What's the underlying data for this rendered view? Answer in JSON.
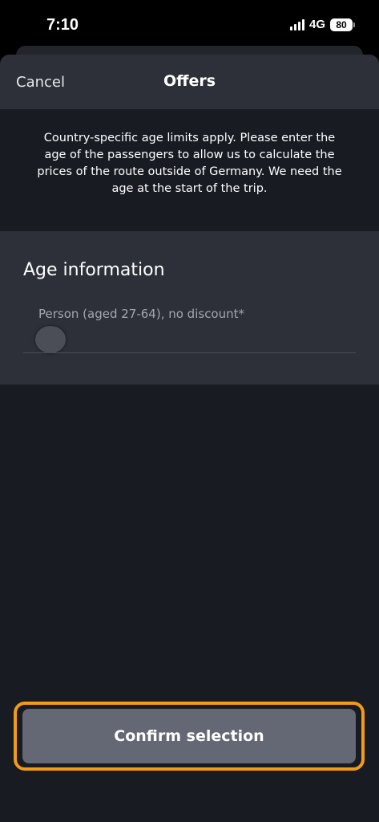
{
  "status_bar": {
    "time": "7:10",
    "network": "4G",
    "battery": "80"
  },
  "nav": {
    "cancel_label": "Cancel",
    "title": "Offers"
  },
  "info_text": "Country-specific age limits apply. Please enter the age of the passengers to allow us to calculate the prices of the route outside of Germany. We need the age at the start of the trip.",
  "age_section": {
    "title": "Age information",
    "person_label": "Person (aged 27-64), no discount*"
  },
  "confirm_label": "Confirm selection",
  "colors": {
    "background": "#181b22",
    "panel": "#2d3038",
    "button": "#636874",
    "highlight": "#f39c12"
  }
}
